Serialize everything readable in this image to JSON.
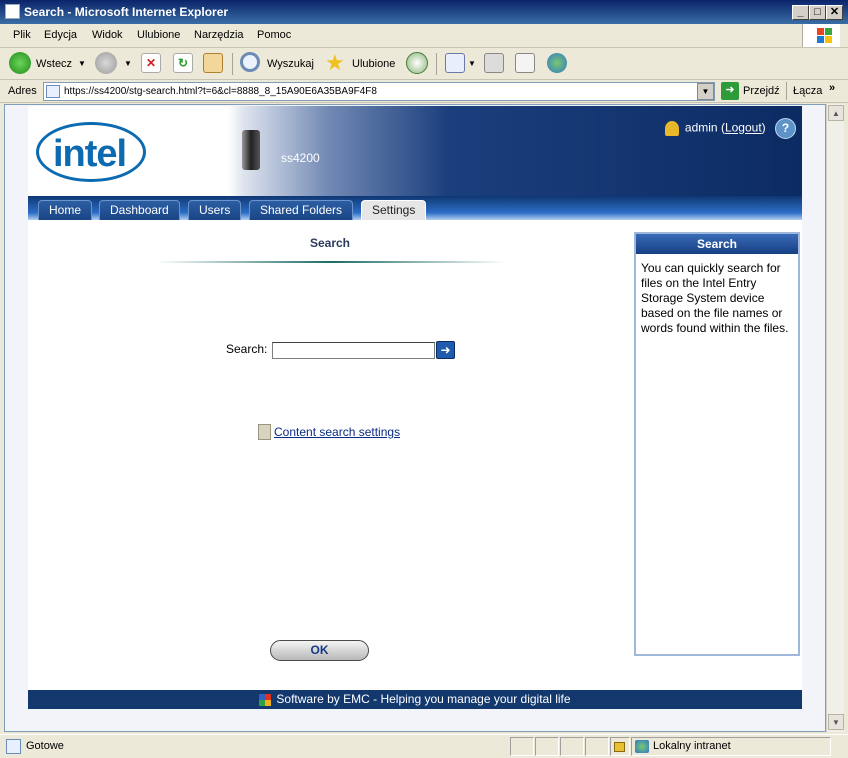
{
  "window": {
    "title": "Search - Microsoft Internet Explorer",
    "minimize": "_",
    "maximize": "□",
    "close": "✕"
  },
  "menubar": {
    "items": [
      "Plik",
      "Edycja",
      "Widok",
      "Ulubione",
      "Narzędzia",
      "Pomoc"
    ]
  },
  "toolbar": {
    "back_label": "Wstecz",
    "search_label": "Wyszukaj",
    "favorites_label": "Ulubione"
  },
  "addressbar": {
    "label": "Adres",
    "url": "https://ss4200/stg-search.html?t=6&cl=8888_8_15A90E6A35BA9F4F8",
    "go_label": "Przejdź",
    "links_label": "Łącza"
  },
  "header": {
    "logo_text": "intel",
    "device_name": "ss4200",
    "user": "admin",
    "logout_label": "Logout"
  },
  "nav": {
    "tabs": [
      "Home",
      "Dashboard",
      "Users",
      "Shared Folders",
      "Settings"
    ],
    "active": "Settings"
  },
  "main": {
    "title": "Search",
    "search_label": "Search:",
    "search_value": "",
    "content_link": "Content search settings",
    "ok_label": "OK"
  },
  "sidepanel": {
    "title": "Search",
    "text": "You can quickly search for files on the Intel Entry Storage System device based on the file names or words found within the files."
  },
  "footer": {
    "text": "Software by EMC - Helping you manage your digital life"
  },
  "statusbar": {
    "status": "Gotowe",
    "zone": "Lokalny intranet"
  },
  "colors": {
    "nav_bg": "#0f3772",
    "header_dark": "#0c2b63",
    "link": "#0b2c86",
    "footer_bg": "#13386e"
  }
}
